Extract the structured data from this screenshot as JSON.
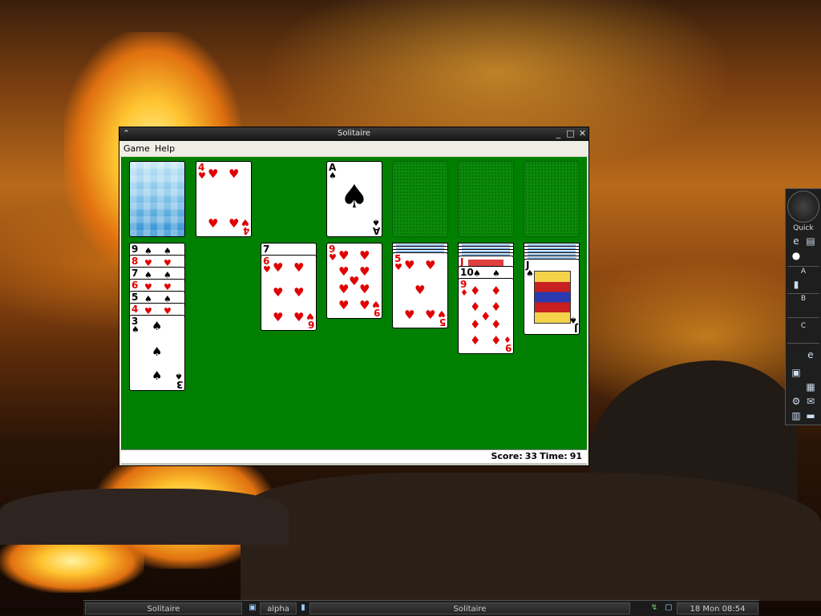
{
  "window": {
    "title": "Solitaire",
    "controls": {
      "minimize": "_",
      "maximize": "□",
      "close": "✕"
    },
    "menu": [
      "Game",
      "Help"
    ],
    "status": {
      "score_label": "Score:",
      "score": "33",
      "time_label": "Time:",
      "time": "91"
    }
  },
  "game": {
    "stock": "face-down",
    "waste": {
      "rank": "4",
      "suit": "♥"
    },
    "foundations": [
      {
        "rank": "A",
        "suit": "♠"
      },
      {
        "empty": true
      },
      {
        "empty": true
      },
      {
        "empty": true
      }
    ],
    "tableau": [
      {
        "cards": [
          {
            "rank": "9",
            "suit": "♠"
          },
          {
            "rank": "8",
            "suit": "♥"
          },
          {
            "rank": "7",
            "suit": "♠"
          },
          {
            "rank": "6",
            "suit": "♥"
          },
          {
            "rank": "5",
            "suit": "♠"
          },
          {
            "rank": "4",
            "suit": "♥"
          },
          {
            "rank": "3",
            "suit": "♠"
          }
        ]
      },
      {
        "cards": []
      },
      {
        "cards": [
          {
            "rank": "7",
            "suit": "♠"
          },
          {
            "rank": "6",
            "suit": "♥"
          }
        ]
      },
      {
        "cards": [
          {
            "rank": "9",
            "suit": "♥"
          }
        ]
      },
      {
        "cards": [
          {
            "rank": "5",
            "suit": "♥"
          }
        ]
      },
      {
        "cards": [
          {
            "rank": "J",
            "suit": "♥"
          },
          {
            "rank": "10",
            "suit": "♠"
          },
          {
            "rank": "9",
            "suit": "♦"
          }
        ]
      },
      {
        "cards": [
          {
            "rank": "J",
            "suit": "♠"
          }
        ]
      }
    ]
  },
  "dock": {
    "quick_label": "Quick",
    "sections": [
      "A",
      "B",
      "C"
    ]
  },
  "taskbar": {
    "items": [
      "Solitaire",
      "alpha",
      "Solitaire"
    ],
    "clock": "18 Mon 08:54"
  },
  "colors": {
    "felt": "#007f00",
    "red": "#e00000",
    "titlebar": "#1f1f1f"
  }
}
